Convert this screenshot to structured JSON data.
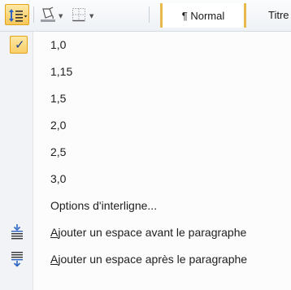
{
  "toolbar": {
    "line_spacing_icon": "line-spacing-icon",
    "shading_icon": "paint-bucket-icon",
    "borders_icon": "borders-icon",
    "style_normal": "¶ Normal",
    "style_title": "Titre"
  },
  "menu": {
    "spacing_options": [
      {
        "label": "1,0",
        "checked": true
      },
      {
        "label": "1,15",
        "checked": false
      },
      {
        "label": "1,5",
        "checked": false
      },
      {
        "label": "2,0",
        "checked": false
      },
      {
        "label": "2,5",
        "checked": false
      },
      {
        "label": "3,0",
        "checked": false
      }
    ],
    "options_label": "Options d'interligne...",
    "add_before": {
      "accel": "A",
      "rest": "jouter un espace avant le paragraphe",
      "icon": "space-before-icon"
    },
    "add_after": {
      "accel": "A",
      "rest": "jouter un espace après le paragraphe",
      "icon": "space-after-icon"
    }
  },
  "colors": {
    "highlight": "#f8cf6a",
    "highlight_border": "#e3a21a",
    "check": "#1b3f8a",
    "arrow_blue": "#2b64c4"
  }
}
